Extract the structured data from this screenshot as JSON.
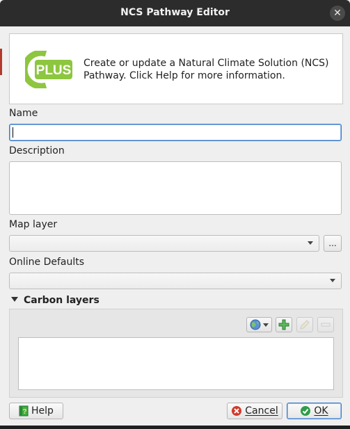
{
  "dialog": {
    "title": "NCS Pathway Editor",
    "close_icon": "close-icon"
  },
  "header": {
    "logo_text": "PLUS",
    "description": "Create or update a Natural Climate Solution (NCS) Pathway. Click Help for more information."
  },
  "form": {
    "name_label": "Name",
    "name_value": "",
    "description_label": "Description",
    "description_value": "",
    "map_layer_label": "Map layer",
    "map_layer_value": "",
    "browse_button": "...",
    "online_defaults_label": "Online Defaults",
    "online_defaults_value": ""
  },
  "carbon_layers": {
    "title": "Carbon layers",
    "tools": [
      "add-online-layer-icon",
      "add-layer-icon",
      "edit-icon",
      "remove-icon"
    ]
  },
  "buttons": {
    "help": "Help",
    "cancel": "Cancel",
    "ok": "OK"
  },
  "colors": {
    "title_bar": "#2c2c2c",
    "logo_green": "#8dc63f",
    "logo_dark_green": "#1e7a3c",
    "focus_blue": "#3a7bc8",
    "cancel_red": "#d23a2a",
    "ok_green": "#2e9d4a"
  }
}
